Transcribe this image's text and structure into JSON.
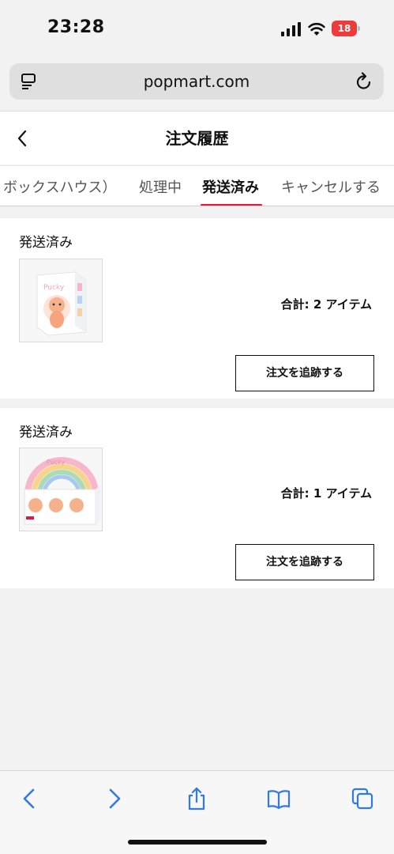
{
  "status_bar": {
    "time": "23:28",
    "battery_text": "18",
    "battery_level": 0.18,
    "battery_color": "#ef3b3b"
  },
  "browser": {
    "url": "popmart.com"
  },
  "header": {
    "title": "注文履歴"
  },
  "tabs": [
    {
      "label": "ボックスハウス）"
    },
    {
      "label": "処理中"
    },
    {
      "label": "発送済み"
    },
    {
      "label": "キャンセルする"
    }
  ],
  "active_tab": "発送済み",
  "accent_color": "#e0183c",
  "orders": [
    {
      "status": "発送済み",
      "total": "合計: 2 アイテム",
      "button": "注文を追跡する"
    },
    {
      "status": "発送済み",
      "total": "合計: 1 アイテム",
      "button": "注文を追跡する"
    }
  ],
  "toolbar": {
    "icons": [
      "back-icon",
      "forward-icon",
      "share-icon",
      "bookmarks-icon",
      "tabs-icon"
    ]
  }
}
